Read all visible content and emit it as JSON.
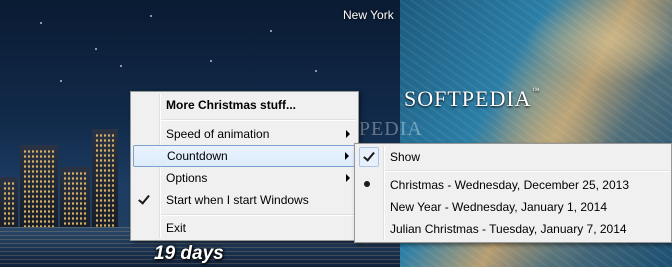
{
  "desktop": {
    "city_label": "New York",
    "watermark": "SOFTPEDIA",
    "watermark_mark": "™",
    "watermark_faint": "SOFTPEDIA",
    "countdown_text": "19 days"
  },
  "context_menu": {
    "items": [
      {
        "label": "More Christmas stuff...",
        "bold": true
      },
      {
        "label": "Speed of animation",
        "submenu": true
      },
      {
        "label": "Countdown",
        "submenu": true,
        "highlighted": true
      },
      {
        "label": "Options",
        "submenu": true
      },
      {
        "label": "Start when I start Windows",
        "checked": true
      },
      {
        "label": "Exit"
      }
    ]
  },
  "countdown_submenu": {
    "items": [
      {
        "label": "Show",
        "checked": true
      },
      {
        "label": "Christmas - Wednesday, December 25, 2013",
        "selected": true
      },
      {
        "label": "New Year - Wednesday, January 1, 2014"
      },
      {
        "label": "Julian Christmas - Tuesday, January 7, 2014"
      }
    ]
  },
  "colors": {
    "menu_bg": "#f0f0f0",
    "highlight_bg": "#dcebfc",
    "highlight_border": "#7da2ce"
  }
}
